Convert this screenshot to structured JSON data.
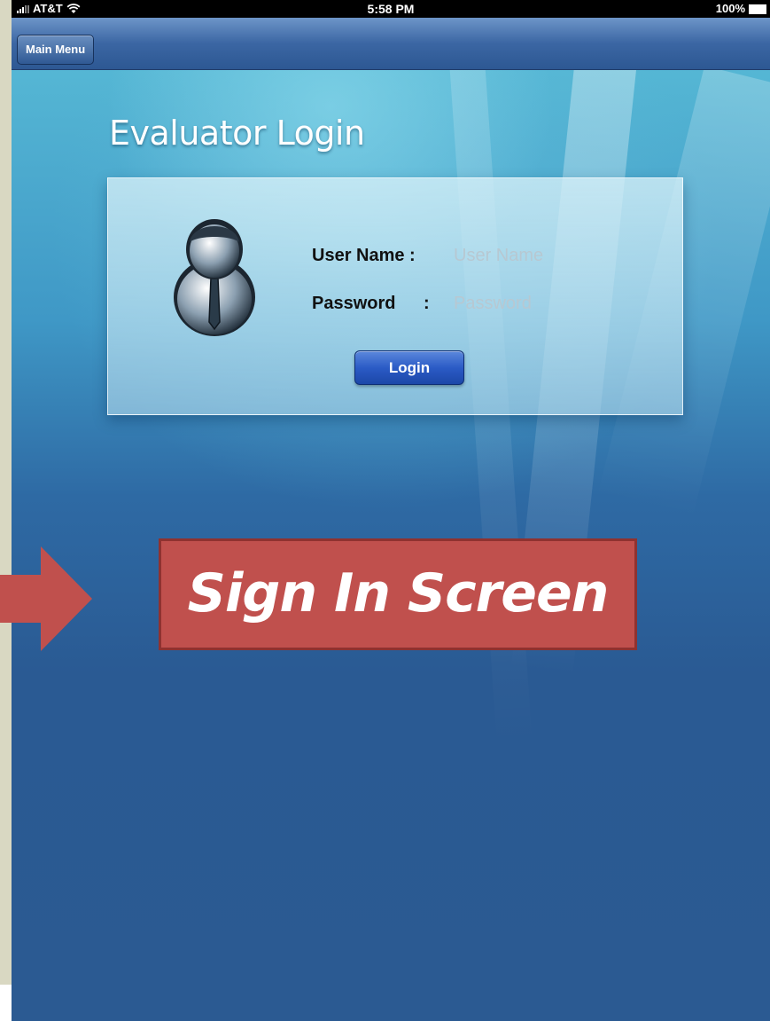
{
  "status_bar": {
    "carrier": "AT&T",
    "time": "5:58 PM",
    "battery": "100%"
  },
  "nav_bar": {
    "main_menu_label": "Main Menu"
  },
  "page": {
    "title": "Evaluator Login"
  },
  "login_form": {
    "user_name_label": "User Name :",
    "user_name_placeholder": "User Name",
    "password_label": "Password",
    "password_colon": ":",
    "password_placeholder": "Password",
    "login_button_label": "Login"
  },
  "callout": {
    "text": "Sign In Screen",
    "color": "#c0504d"
  },
  "icons": {
    "signal": "signal-bars-icon",
    "wifi": "wifi-icon",
    "battery": "battery-icon",
    "avatar": "user-avatar-icon",
    "arrow": "right-arrow-icon"
  }
}
